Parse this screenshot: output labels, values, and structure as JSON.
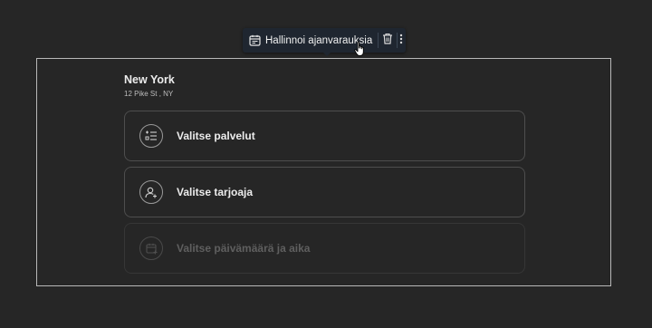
{
  "toolbar": {
    "manage_label": "Hallinnoi ajanvarauksia",
    "manage_icon": "calendar-icon",
    "delete_icon": "trash-icon",
    "more_icon": "more-vertical-icon"
  },
  "location": {
    "name": "New York",
    "address": "12 Pike St , NY"
  },
  "steps": [
    {
      "label": "Valitse palvelut",
      "icon": "service-list-icon",
      "enabled": true
    },
    {
      "label": "Valitse tarjoaja",
      "icon": "add-user-icon",
      "enabled": true
    },
    {
      "label": "Valitse päivämäärä ja aika",
      "icon": "calendar-add-icon",
      "enabled": false
    }
  ],
  "colors": {
    "background": "#262626",
    "toolbar": "#1f2630",
    "selection_border": "#b8b8b8",
    "text_primary": "#ececec",
    "text_disabled": "#5f5f5f"
  }
}
